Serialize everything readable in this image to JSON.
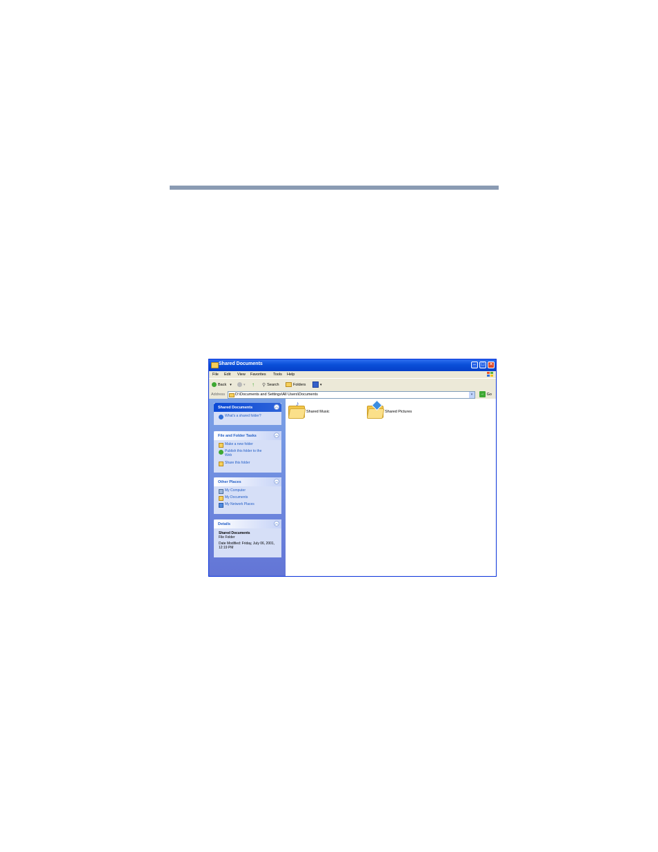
{
  "window": {
    "title": "Shared Documents"
  },
  "menu": [
    "File",
    "Edit",
    "View",
    "Favorites",
    "Tools",
    "Help"
  ],
  "toolbar": {
    "back": "Back",
    "search": "Search",
    "folders": "Folders"
  },
  "address": {
    "label": "Address",
    "value": "D:\\Documents and Settings\\All Users\\Documents",
    "go": "Go"
  },
  "panels": {
    "shared": {
      "title": "Shared Documents",
      "link": "What's a shared folder?"
    },
    "tasks": {
      "title": "File and Folder Tasks",
      "items": [
        "Make a new folder",
        "Publish this folder to the Web",
        "Share this folder"
      ]
    },
    "places": {
      "title": "Other Places",
      "items": [
        "My Computer",
        "My Documents",
        "My Network Places"
      ]
    },
    "details": {
      "title": "Details",
      "name": "Shared Documents",
      "type": "File Folder",
      "modified": "Date Modified: Friday, July 06, 2001, 12:19 PM"
    }
  },
  "folders": [
    {
      "name": "Shared Music",
      "icon": "music-folder-icon"
    },
    {
      "name": "Shared Pictures",
      "icon": "pictures-folder-icon"
    }
  ],
  "colors": {
    "titlebar": "#0a4fd8",
    "sidebar": "#6f8ee0",
    "link": "#215dc6"
  }
}
